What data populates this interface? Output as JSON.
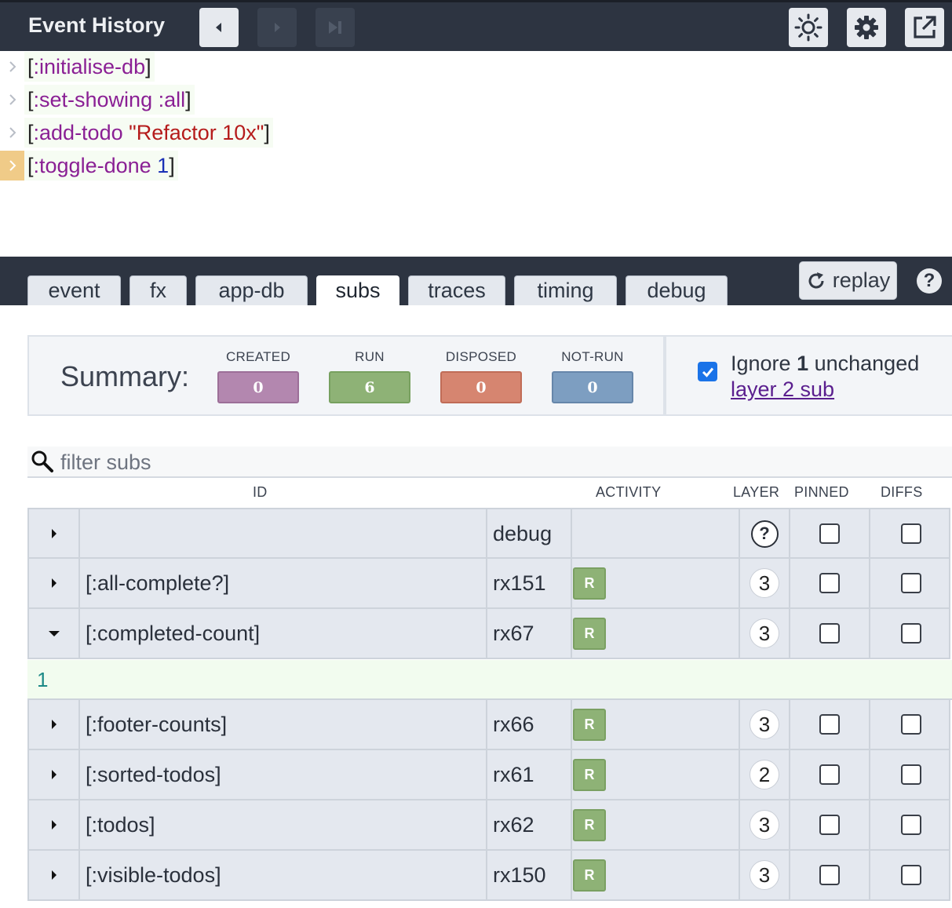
{
  "header": {
    "title": "Event History",
    "buttons": [
      {
        "icon": "step-back-icon",
        "enabled": true
      },
      {
        "icon": "step-forward-icon",
        "enabled": false
      },
      {
        "icon": "skip-to-end-icon",
        "enabled": false
      },
      {
        "icon": "sun-icon"
      },
      {
        "icon": "gear-icon"
      },
      {
        "icon": "open-external-icon"
      }
    ]
  },
  "events": [
    {
      "open": "[",
      "kw": ":initialise-db",
      "rest": "",
      "rest_type": "",
      "close": "]",
      "selected": false
    },
    {
      "open": "[",
      "kw": ":set-showing :all",
      "rest": "",
      "rest_type": "",
      "close": "]",
      "selected": false
    },
    {
      "open": "[",
      "kw": ":add-todo",
      "rest": "\"Refactor 10x\"",
      "rest_type": "str",
      "close": "]",
      "selected": false
    },
    {
      "open": "[",
      "kw": ":toggle-done",
      "rest": "1",
      "rest_type": "num",
      "close": "]",
      "selected": true
    }
  ],
  "tabs": {
    "items": [
      "event",
      "fx",
      "app-db",
      "subs",
      "traces",
      "timing",
      "debug"
    ],
    "active": "subs"
  },
  "toolbar": {
    "replay_label": "replay",
    "help_label": "?"
  },
  "summary": {
    "label": "Summary:",
    "stats": [
      {
        "caption": "CREATED",
        "value": "0",
        "color": "#b387af"
      },
      {
        "caption": "RUN",
        "value": "6",
        "color": "#8eb276"
      },
      {
        "caption": "DISPOSED",
        "value": "0",
        "color": "#d68570"
      },
      {
        "caption": "NOT-RUN",
        "value": "0",
        "color": "#7d9ec1"
      }
    ],
    "ignore": {
      "checked": true,
      "text_before": "Ignore ",
      "count": "1",
      "text_after": " unchanged",
      "link": "layer 2 sub"
    }
  },
  "filter": {
    "placeholder": "filter subs"
  },
  "table": {
    "columns": {
      "id": "ID",
      "activity": "ACTIVITY",
      "layer": "LAYER",
      "pinned": "PINNED",
      "diffs": "DIFFS"
    },
    "rows": [
      {
        "id": "",
        "rx": "debug",
        "activity": "",
        "layer": "?",
        "expanded": false
      },
      {
        "id": "[:all-complete?]",
        "rx": "rx151",
        "activity": "R",
        "layer": "3",
        "expanded": false
      },
      {
        "id": "[:completed-count]",
        "rx": "rx67",
        "activity": "R",
        "layer": "3",
        "expanded": true,
        "value": "1"
      },
      {
        "id": "[:footer-counts]",
        "rx": "rx66",
        "activity": "R",
        "layer": "3",
        "expanded": false
      },
      {
        "id": "[:sorted-todos]",
        "rx": "rx61",
        "activity": "R",
        "layer": "2",
        "expanded": false
      },
      {
        "id": "[:todos]",
        "rx": "rx62",
        "activity": "R",
        "layer": "3",
        "expanded": false
      },
      {
        "id": "[:visible-todos]",
        "rx": "rx150",
        "activity": "R",
        "layer": "3",
        "expanded": false
      }
    ]
  }
}
